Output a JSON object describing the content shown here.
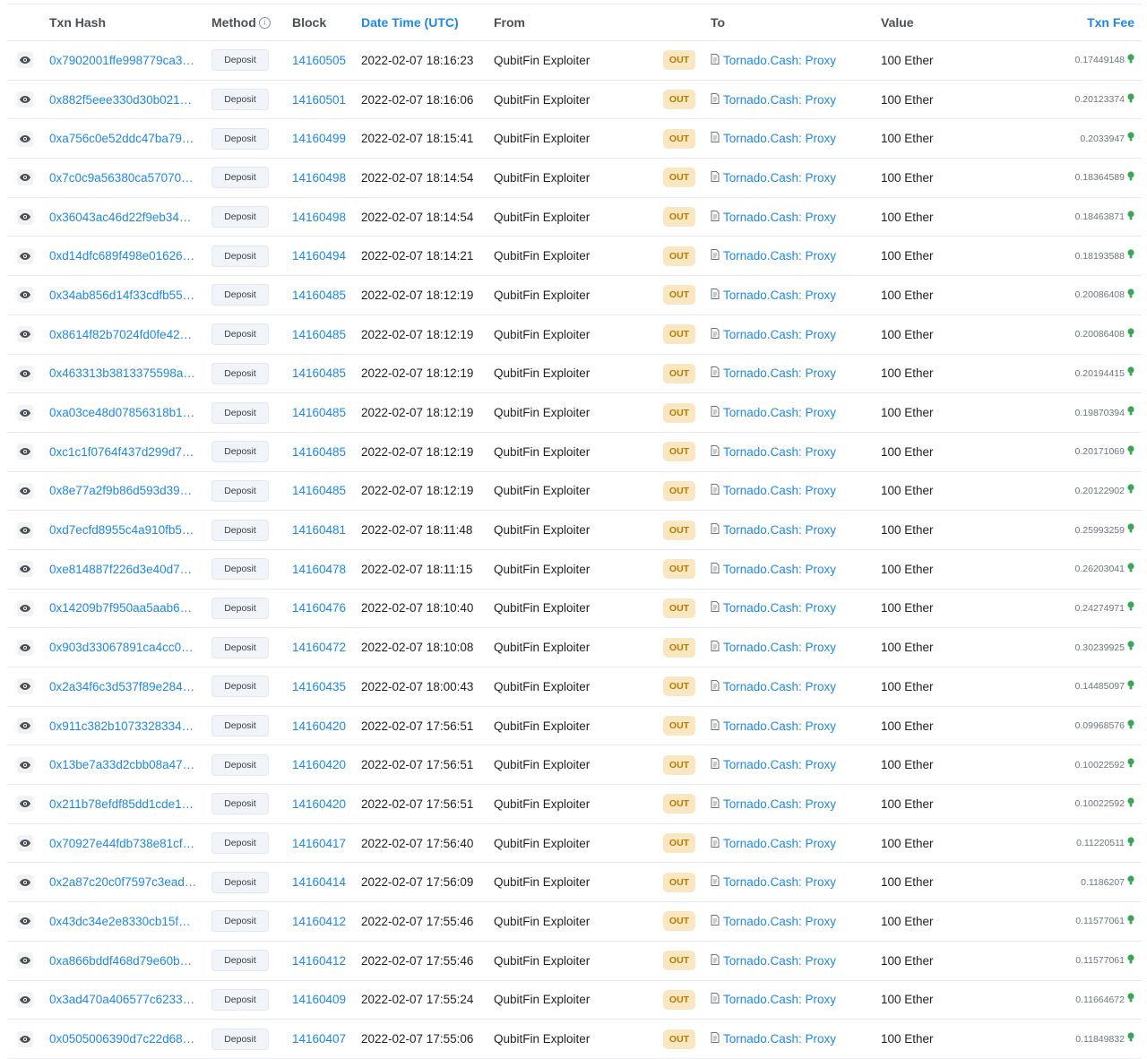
{
  "header": {
    "txn_hash": "Txn Hash",
    "method": "Method",
    "block": "Block",
    "date_time": "Date Time (UTC)",
    "from": "From",
    "to": "To",
    "value": "Value",
    "txn_fee": "Txn Fee",
    "info_glyph": "i"
  },
  "colors": {
    "link": "#1e88e5",
    "out_badge_bg": "#fbe6c2",
    "out_badge_text": "#b47d00",
    "gas_icon": "#3aa757"
  },
  "icons": {
    "eye": "eye-icon",
    "contract": "file-contract-icon",
    "gas": "gas-bulb-icon"
  },
  "rows": [
    {
      "hash": "0x7902001ffe998779ca3…",
      "method": "Deposit",
      "block": "14160505",
      "time": "2022-02-07 18:16:23",
      "from": "QubitFin Exploiter",
      "dir": "OUT",
      "to": "Tornado.Cash: Proxy",
      "value": "100 Ether",
      "fee": "0.17449148"
    },
    {
      "hash": "0x882f5eee330d30b021…",
      "method": "Deposit",
      "block": "14160501",
      "time": "2022-02-07 18:16:06",
      "from": "QubitFin Exploiter",
      "dir": "OUT",
      "to": "Tornado.Cash: Proxy",
      "value": "100 Ether",
      "fee": "0.20123374"
    },
    {
      "hash": "0xa756c0e52ddc47ba79…",
      "method": "Deposit",
      "block": "14160499",
      "time": "2022-02-07 18:15:41",
      "from": "QubitFin Exploiter",
      "dir": "OUT",
      "to": "Tornado.Cash: Proxy",
      "value": "100 Ether",
      "fee": "0.2033947"
    },
    {
      "hash": "0x7c0c9a56380ca57070…",
      "method": "Deposit",
      "block": "14160498",
      "time": "2022-02-07 18:14:54",
      "from": "QubitFin Exploiter",
      "dir": "OUT",
      "to": "Tornado.Cash: Proxy",
      "value": "100 Ether",
      "fee": "0.18364589"
    },
    {
      "hash": "0x36043ac46d22f9eb34…",
      "method": "Deposit",
      "block": "14160498",
      "time": "2022-02-07 18:14:54",
      "from": "QubitFin Exploiter",
      "dir": "OUT",
      "to": "Tornado.Cash: Proxy",
      "value": "100 Ether",
      "fee": "0.18463871"
    },
    {
      "hash": "0xd14dfc689f498e01626…",
      "method": "Deposit",
      "block": "14160494",
      "time": "2022-02-07 18:14:21",
      "from": "QubitFin Exploiter",
      "dir": "OUT",
      "to": "Tornado.Cash: Proxy",
      "value": "100 Ether",
      "fee": "0.18193588"
    },
    {
      "hash": "0x34ab856d14f33cdfb55…",
      "method": "Deposit",
      "block": "14160485",
      "time": "2022-02-07 18:12:19",
      "from": "QubitFin Exploiter",
      "dir": "OUT",
      "to": "Tornado.Cash: Proxy",
      "value": "100 Ether",
      "fee": "0.20086408"
    },
    {
      "hash": "0x8614f82b7024fd0fe42…",
      "method": "Deposit",
      "block": "14160485",
      "time": "2022-02-07 18:12:19",
      "from": "QubitFin Exploiter",
      "dir": "OUT",
      "to": "Tornado.Cash: Proxy",
      "value": "100 Ether",
      "fee": "0.20086408"
    },
    {
      "hash": "0x463313b3813375598a…",
      "method": "Deposit",
      "block": "14160485",
      "time": "2022-02-07 18:12:19",
      "from": "QubitFin Exploiter",
      "dir": "OUT",
      "to": "Tornado.Cash: Proxy",
      "value": "100 Ether",
      "fee": "0.20194415"
    },
    {
      "hash": "0xa03ce48d07856318b1…",
      "method": "Deposit",
      "block": "14160485",
      "time": "2022-02-07 18:12:19",
      "from": "QubitFin Exploiter",
      "dir": "OUT",
      "to": "Tornado.Cash: Proxy",
      "value": "100 Ether",
      "fee": "0.19870394"
    },
    {
      "hash": "0xc1c1f0764f437d299d7…",
      "method": "Deposit",
      "block": "14160485",
      "time": "2022-02-07 18:12:19",
      "from": "QubitFin Exploiter",
      "dir": "OUT",
      "to": "Tornado.Cash: Proxy",
      "value": "100 Ether",
      "fee": "0.20171069"
    },
    {
      "hash": "0x8e77a2f9b86d593d39…",
      "method": "Deposit",
      "block": "14160485",
      "time": "2022-02-07 18:12:19",
      "from": "QubitFin Exploiter",
      "dir": "OUT",
      "to": "Tornado.Cash: Proxy",
      "value": "100 Ether",
      "fee": "0.20122902"
    },
    {
      "hash": "0xd7ecfd8955c4a910fb5…",
      "method": "Deposit",
      "block": "14160481",
      "time": "2022-02-07 18:11:48",
      "from": "QubitFin Exploiter",
      "dir": "OUT",
      "to": "Tornado.Cash: Proxy",
      "value": "100 Ether",
      "fee": "0.25993259"
    },
    {
      "hash": "0xe814887f226d3e40d7…",
      "method": "Deposit",
      "block": "14160478",
      "time": "2022-02-07 18:11:15",
      "from": "QubitFin Exploiter",
      "dir": "OUT",
      "to": "Tornado.Cash: Proxy",
      "value": "100 Ether",
      "fee": "0.26203041"
    },
    {
      "hash": "0x14209b7f950aa5aab6…",
      "method": "Deposit",
      "block": "14160476",
      "time": "2022-02-07 18:10:40",
      "from": "QubitFin Exploiter",
      "dir": "OUT",
      "to": "Tornado.Cash: Proxy",
      "value": "100 Ether",
      "fee": "0.24274971"
    },
    {
      "hash": "0x903d33067891ca4cc0…",
      "method": "Deposit",
      "block": "14160472",
      "time": "2022-02-07 18:10:08",
      "from": "QubitFin Exploiter",
      "dir": "OUT",
      "to": "Tornado.Cash: Proxy",
      "value": "100 Ether",
      "fee": "0.30239925"
    },
    {
      "hash": "0x2a34f6c3d537f89e284…",
      "method": "Deposit",
      "block": "14160435",
      "time": "2022-02-07 18:00:43",
      "from": "QubitFin Exploiter",
      "dir": "OUT",
      "to": "Tornado.Cash: Proxy",
      "value": "100 Ether",
      "fee": "0.14485097"
    },
    {
      "hash": "0x911c382b1073328334…",
      "method": "Deposit",
      "block": "14160420",
      "time": "2022-02-07 17:56:51",
      "from": "QubitFin Exploiter",
      "dir": "OUT",
      "to": "Tornado.Cash: Proxy",
      "value": "100 Ether",
      "fee": "0.09968576"
    },
    {
      "hash": "0x13be7a33d2cbb08a47…",
      "method": "Deposit",
      "block": "14160420",
      "time": "2022-02-07 17:56:51",
      "from": "QubitFin Exploiter",
      "dir": "OUT",
      "to": "Tornado.Cash: Proxy",
      "value": "100 Ether",
      "fee": "0.10022592"
    },
    {
      "hash": "0x211b78efdf85dd1cde1…",
      "method": "Deposit",
      "block": "14160420",
      "time": "2022-02-07 17:56:51",
      "from": "QubitFin Exploiter",
      "dir": "OUT",
      "to": "Tornado.Cash: Proxy",
      "value": "100 Ether",
      "fee": "0.10022592"
    },
    {
      "hash": "0x70927e44fdb738e81cf…",
      "method": "Deposit",
      "block": "14160417",
      "time": "2022-02-07 17:56:40",
      "from": "QubitFin Exploiter",
      "dir": "OUT",
      "to": "Tornado.Cash: Proxy",
      "value": "100 Ether",
      "fee": "0.11220511"
    },
    {
      "hash": "0x2a87c20c0f7597c3ead…",
      "method": "Deposit",
      "block": "14160414",
      "time": "2022-02-07 17:56:09",
      "from": "QubitFin Exploiter",
      "dir": "OUT",
      "to": "Tornado.Cash: Proxy",
      "value": "100 Ether",
      "fee": "0.1186207"
    },
    {
      "hash": "0x43dc34e2e8330cb15f…",
      "method": "Deposit",
      "block": "14160412",
      "time": "2022-02-07 17:55:46",
      "from": "QubitFin Exploiter",
      "dir": "OUT",
      "to": "Tornado.Cash: Proxy",
      "value": "100 Ether",
      "fee": "0.11577061"
    },
    {
      "hash": "0xa866bddf468d79e60b…",
      "method": "Deposit",
      "block": "14160412",
      "time": "2022-02-07 17:55:46",
      "from": "QubitFin Exploiter",
      "dir": "OUT",
      "to": "Tornado.Cash: Proxy",
      "value": "100 Ether",
      "fee": "0.11577061"
    },
    {
      "hash": "0x3ad470a406577c6233…",
      "method": "Deposit",
      "block": "14160409",
      "time": "2022-02-07 17:55:24",
      "from": "QubitFin Exploiter",
      "dir": "OUT",
      "to": "Tornado.Cash: Proxy",
      "value": "100 Ether",
      "fee": "0.11664672"
    },
    {
      "hash": "0x0505006390d7c22d68…",
      "method": "Deposit",
      "block": "14160407",
      "time": "2022-02-07 17:55:06",
      "from": "QubitFin Exploiter",
      "dir": "OUT",
      "to": "Tornado.Cash: Proxy",
      "value": "100 Ether",
      "fee": "0.11849832"
    }
  ]
}
